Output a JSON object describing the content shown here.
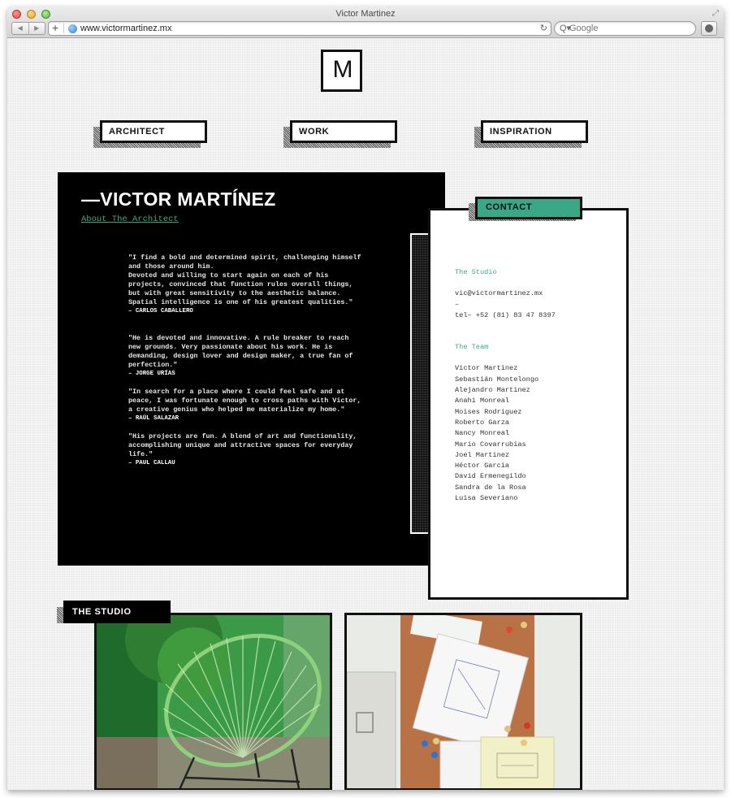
{
  "browser": {
    "window_title": "Victor Martinez",
    "url": "www.victormartinez.mx",
    "search_placeholder": "Google",
    "icons": {
      "back": "◀",
      "forward": "▶",
      "add": "+",
      "reload": "↻",
      "search": "Q▾",
      "fullscreen": "⤢"
    }
  },
  "site": {
    "logo": "M",
    "nav": [
      {
        "label": "ARCHITECT"
      },
      {
        "label": "WORK"
      },
      {
        "label": "INSPIRATION"
      }
    ],
    "hero": {
      "title": "—VICTOR MARTÍNEZ",
      "about_link": "About The Architect"
    },
    "quotes": [
      {
        "text": "\"I find a bold and determined spirit, challenging himself\nand those around him.\nDevoted and willing to start again on each of his\nprojects, convinced that function rules overall things,\nbut with great sensitivity to the aesthetic balance.\nSpatial intelligence is one of his greatest qualities.\"",
        "author": "– CARLOS CABALLERO"
      },
      {
        "text": "\"He is devoted and innovative. A rule breaker to reach\nnew grounds. Very passionate about his work. He is\ndemanding, design lover and design maker, a true fan of\nperfection.\"",
        "author": "– JORGE URÍAS"
      },
      {
        "text": "\"In search for a place where I could feel safe and at\npeace, I was fortunate enough to cross paths with Victor,\na creative genius who helped me materialize my home.\"",
        "author": "– RAÚL SALAZAR"
      },
      {
        "text": "\"His projects are fun. A blend of art and functionality,\naccomplishing unique and attractive spaces for everyday\nlife.\"",
        "author": "– PAUL CALLAU"
      }
    ],
    "contact": {
      "tab_label": "CONTACT",
      "studio_heading": "The Studio",
      "email": "vic@victormartinez.mx",
      "separator": "–",
      "phone": "tel– +52 (81) 83 47 8397",
      "team_heading": "The Team",
      "team": [
        "Victor Martinez",
        "Sebastián Montelongo",
        "Alejandro Martinez",
        "Anahi Monreal",
        "Moises Rodriguez",
        "Roberto Garza",
        "Nancy Monreal",
        "Mario Covarrubias",
        "Joel Martinez",
        "Héctor Garcia",
        "David Ermenegildo",
        "Sandra de la Rosa",
        "Luisa Severiano"
      ]
    },
    "studio": {
      "label": "THE STUDIO",
      "photos": [
        {
          "alt": "Green woven chair in front of a green wall with ferns"
        },
        {
          "alt": "Cork board with pinned architectural sketches next to a filing cabinet"
        }
      ]
    },
    "colors": {
      "accent": "#3aa886",
      "panel": "#000000",
      "border": "#111111"
    }
  }
}
